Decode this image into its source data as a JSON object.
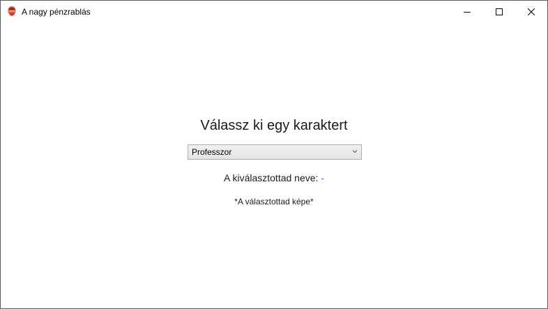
{
  "window": {
    "title": "A nagy pénzrablás",
    "icon": "mask-icon",
    "controls": {
      "minimize": "minimize-icon",
      "maximize": "maximize-icon",
      "close": "close-icon"
    }
  },
  "main": {
    "heading": "Válassz ki egy karaktert",
    "character_select": {
      "selected": "Professzor"
    },
    "selected_label": "A kiválasztottad neve:",
    "selected_name": "-",
    "image_placeholder": "*A választottad képe*"
  },
  "colors": {
    "accent": "#1e7bd6"
  }
}
